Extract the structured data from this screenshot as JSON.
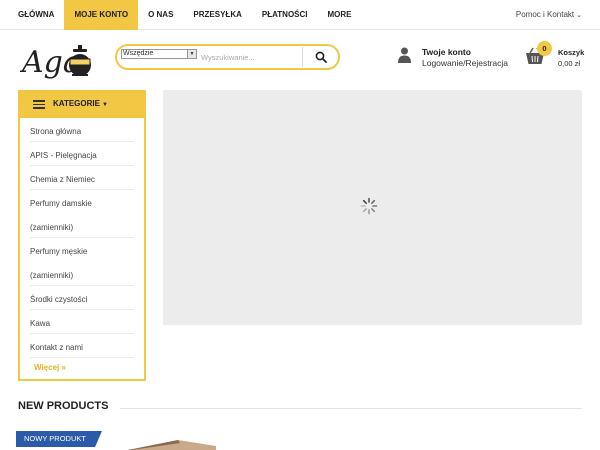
{
  "top_nav": {
    "items": [
      {
        "label": "GŁÓWNA"
      },
      {
        "label": "MOJE KONTO",
        "active": true
      },
      {
        "label": "O NAS"
      },
      {
        "label": "PRZESYŁKA"
      },
      {
        "label": "PŁATNOŚCI"
      },
      {
        "label": "MORE"
      }
    ],
    "help_link": "Pomoc i Kontakt"
  },
  "header": {
    "logo_text": "Aga",
    "search": {
      "category_select": "Wszędzie",
      "placeholder": "Wyszukiwanie..."
    },
    "account": {
      "title": "Twoje konto",
      "subtitle": "Logowanie/Rejestracja"
    },
    "cart": {
      "count": "0",
      "label": "Koszyk",
      "total": "0,00 zł"
    }
  },
  "sidebar": {
    "title": "KATEGORIE",
    "items": [
      {
        "label": "Strona główna"
      },
      {
        "label": "APIS - Pielęgnacja"
      },
      {
        "label": "Chemia z Niemiec"
      },
      {
        "label": "Perfumy damskie"
      },
      {
        "label": "(zamienniki)"
      },
      {
        "label": "Perfumy męskie"
      },
      {
        "label": "(zamienniki)"
      },
      {
        "label": "Środki czystości"
      },
      {
        "label": "Kawa"
      },
      {
        "label": "Kontakt z nami"
      }
    ],
    "more_label": "Więcej »"
  },
  "main": {
    "section_title": "NEW PRODUCTS",
    "product_badge": "NOWY PRODUKT"
  },
  "colors": {
    "accent": "#f2c744",
    "badge_blue": "#2b5aa8",
    "slider_bg": "#ececec"
  },
  "icons": {
    "search": "search-icon",
    "user": "user-icon",
    "cart": "basket-icon",
    "menu": "hamburger-icon",
    "loading": "spinner-icon"
  }
}
